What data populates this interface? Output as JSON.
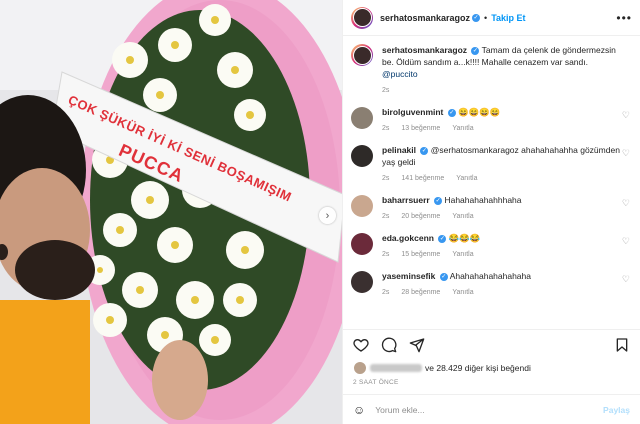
{
  "header": {
    "username": "serhatosmankaragoz",
    "separator": "•",
    "follow_label": "Takip Et",
    "more_icon": "more-horizontal-icon"
  },
  "photo": {
    "ribbon_line1": "ÇOK ŞÜKÜR İYİ Kİ SENİ BOŞAMIŞIM",
    "ribbon_line2": "PUCCA",
    "next_icon": "chevron-right-icon"
  },
  "caption": {
    "username": "serhatosmankaragoz",
    "text": "Tamam da çelenk de göndermezsin be. Öldüm sandım a...k!!!! Mahalle cenazem var sandı.",
    "mention": "@puccito",
    "time": "2s"
  },
  "comments": [
    {
      "username": "birolguvenmint",
      "text": "😄😄😄😄",
      "time": "2s",
      "likes": "13 beğenme",
      "reply": "Yanıtla",
      "avatar_color": "#8a7f72"
    },
    {
      "username": "pelinakil",
      "text": "@serhatosmankaragoz ahahahahahha gözümden yaş geldi",
      "time": "2s",
      "likes": "141 beğenme",
      "reply": "Yanıtla",
      "avatar_color": "#2e2a28"
    },
    {
      "username": "baharrsuerr",
      "text": "Hahahahahahhhaha",
      "time": "2s",
      "likes": "20 beğenme",
      "reply": "Yanıtla",
      "avatar_color": "#c9a78f"
    },
    {
      "username": "eda.gokcenn",
      "text": "😂😂😂",
      "time": "2s",
      "likes": "15 beğenme",
      "reply": "Yanıtla",
      "avatar_color": "#6b2a3a"
    },
    {
      "username": "yaseminsefik",
      "text": "Ahahahahahahahaha",
      "time": "2s",
      "likes": "28 beğenme",
      "reply": "Yanıtla",
      "avatar_color": "#3a3030"
    }
  ],
  "likes": {
    "text": "ve 28.429 diğer kişi beğendi"
  },
  "timestamp": "2 SAAT ÖNCE",
  "composer": {
    "placeholder": "Yorum ekle...",
    "share_label": "Paylaş"
  },
  "colors": {
    "accent": "#0095f6",
    "verified": "#3897f0",
    "ribbon_text": "#e0313a",
    "wreath_pink": "#f1a7cd"
  }
}
